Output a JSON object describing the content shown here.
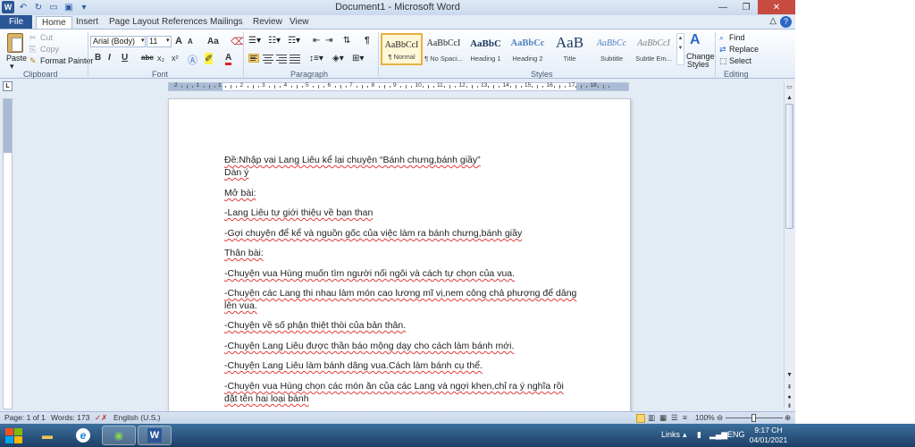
{
  "window": {
    "title": "Document1  -  Microsoft Word"
  },
  "qat": {
    "icons": [
      "word-logo-icon",
      "undo-icon",
      "redo-icon",
      "open-icon",
      "save-icon",
      "customize-icon"
    ]
  },
  "tabs": [
    {
      "label": "File"
    },
    {
      "label": "Home"
    },
    {
      "label": "Insert"
    },
    {
      "label": "Page Layout"
    },
    {
      "label": "References"
    },
    {
      "label": "Mailings"
    },
    {
      "label": "Review"
    },
    {
      "label": "View"
    }
  ],
  "ribbon": {
    "clipboard": {
      "paste": "Paste",
      "cut": "Cut",
      "copy": "Copy",
      "format_painter": "Format Painter",
      "label": "Clipboard"
    },
    "font": {
      "name": "Arial (Body)",
      "size": "11",
      "label": "Font",
      "bold": "B",
      "italic": "I",
      "underline": "U",
      "strike": "abc",
      "sub": "x₂",
      "sup": "x²",
      "grow": "A",
      "shrink": "A",
      "change_case": "Aa"
    },
    "paragraph": {
      "label": "Paragraph",
      "pilcrow": "¶"
    },
    "styles": {
      "label": "Styles",
      "items": [
        {
          "sample": "AaBbCcI",
          "name": "¶ Normal"
        },
        {
          "sample": "AaBbCcI",
          "name": "¶ No Spaci..."
        },
        {
          "sample": "AaBbC",
          "name": "Heading 1"
        },
        {
          "sample": "AaBbCc",
          "name": "Heading 2"
        },
        {
          "sample": "AaB",
          "name": "Title"
        },
        {
          "sample": "AaBbCc",
          "name": "Subtitle"
        },
        {
          "sample": "AaBbCcI",
          "name": "Subtle Em..."
        }
      ],
      "change_styles": "Change",
      "change_styles2": "Styles"
    },
    "editing": {
      "label": "Editing",
      "find": "Find",
      "replace": "Replace",
      "select": "Select"
    }
  },
  "ruler_numbers": [
    "2",
    "1",
    "1",
    "2",
    "3",
    "4",
    "5",
    "6",
    "7",
    "8",
    "9",
    "10",
    "11",
    "12",
    "13",
    "14",
    "15",
    "16",
    "17",
    "18"
  ],
  "document": {
    "lines": [
      "Đề:Nhập vai Lang Liêu kể lại chuyện “Bánh chưng,bánh giầy”",
      "Dàn ý",
      "Mở bài:",
      "-Lang Liêu tự giới thiệu về bạn than",
      "-Gợi chuyện để kể và nguồn gốc của việc làm ra bánh chưng,bánh giầy",
      "Thân bài:",
      "-Chuyện vua Hùng muốn tìm người nối ngôi và cách tự chọn của vua.",
      "-Chuyện các Lang thi nhau làm món cao lương mĩ vị,nem công chả phượng để dâng",
      "lên vua.",
      "-Chuyện về số phận thiệt thòi của bản thân.",
      "-Chuyện Lang Liêu được thần báo mộng dạy cho cách làm bánh mới.",
      "-Chuyện Lang Liêu làm bánh dâng vua.Cách làm bánh cụ thể.",
      "-Chuyện vua Hùng chọn các món ăn của các Lang và ngợi khen,chỉ ra ý nghĩa rồi",
      "đặt tên hai loại bánh"
    ]
  },
  "statusbar": {
    "page": "Page: 1 of 1",
    "words": "Words: 173",
    "language": "English (U.S.)",
    "zoom": "100%",
    "zoom_level": 0.5
  },
  "taskbar": {
    "links": "Links",
    "lang": "ENG",
    "time": "9:17 CH",
    "date": "04/01/2021",
    "colors": {
      "word": "#2b5797",
      "ie": "#1e88d6"
    }
  }
}
